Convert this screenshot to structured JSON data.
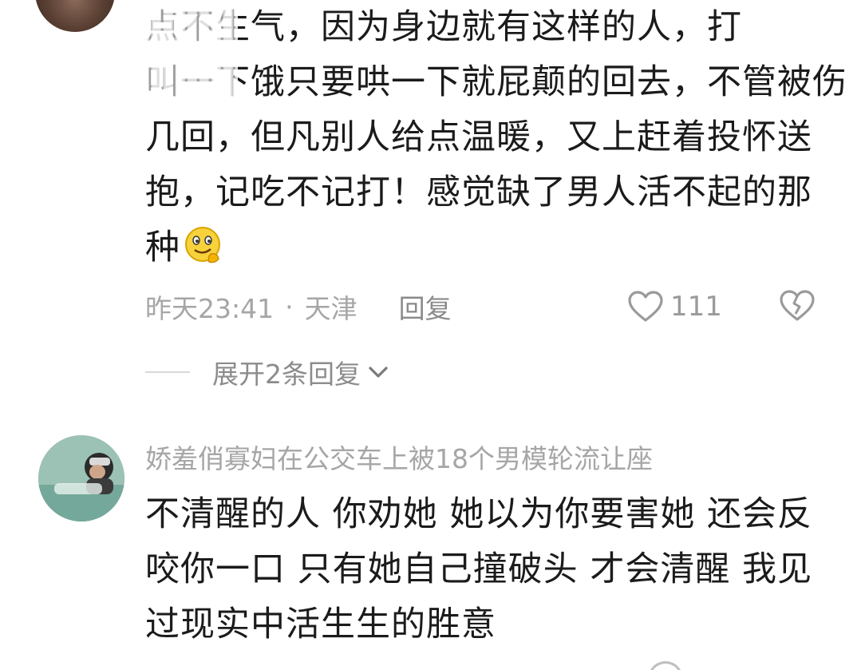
{
  "comment1": {
    "lines": [
      "点不生气，因为身边就有这样的人，打",
      "叫一下饿只要哄一下就屁颠的回去，不管被伤",
      "几回，但凡别人给点温暖，又上赶着投怀送",
      "抱，记吃不记打！感觉缺了男人活不起的那",
      "种"
    ],
    "emoji": "smirk-face-emoji",
    "time": "昨天23:41",
    "separator": "·",
    "location": "天津",
    "reply_label": "回复",
    "like_count": "111",
    "expand_label": "展开2条回复"
  },
  "comment2": {
    "username": "娇羞俏寡妇在公交车上被18个男模轮流让座",
    "lines": [
      "不清醒的人 你劝她 她以为你要害她 还会反",
      "咬你一口 只有她自己撞破头 才会清醒 我见",
      "过现实中活生生的胜意"
    ]
  },
  "icons": {
    "like": "heart-outline-icon",
    "dislike": "broken-heart-icon",
    "expand": "chevron-down-icon"
  },
  "colors": {
    "text": "#1b1b1b",
    "meta": "#a6a6a6",
    "divider": "#d9d9d9"
  }
}
